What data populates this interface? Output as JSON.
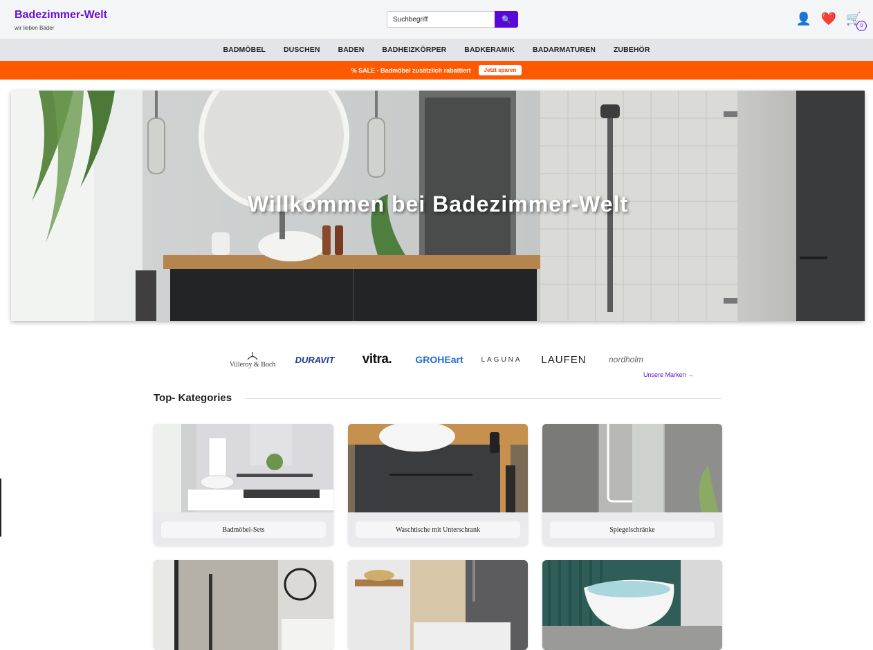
{
  "header": {
    "logo_title": "Badezimmer-Welt",
    "logo_subtitle": "wir lieben Bäder",
    "search_placeholder": "Suchbegriff",
    "search_button_icon": "🔍",
    "account_icon": "👤",
    "wishlist_icon": "❤️",
    "cart_icon": "🛒",
    "cart_count": "0"
  },
  "nav": {
    "items": [
      "BADMÖBEL",
      "DUSCHEN",
      "BADEN",
      "BADHEIZKÖRPER",
      "BADKERAMIK",
      "BADARMATUREN",
      "ZUBEHÖR"
    ]
  },
  "sale": {
    "text": "% SALE - Badmöbel zusätzlich rabattiert",
    "button": "Jetzt sparen",
    "color": "#ff5a00"
  },
  "hero": {
    "title": "Willkommen bei Badezimmer-Welt"
  },
  "brands": {
    "items": [
      "Villeroy & Boch",
      "DURAVIT",
      "vitra.",
      "GROHEart",
      "LAGUNA",
      "LAUFEN",
      "nordholm"
    ],
    "link": "Unsere Marken →"
  },
  "categories": {
    "title": "Top- Kategories",
    "items": [
      "Badmöbel-Sets",
      "Waschtische mit Unterschrank",
      "Spiegelschränke"
    ]
  },
  "colors": {
    "accent": "#5a08d8",
    "logo": "#6a10d6"
  }
}
